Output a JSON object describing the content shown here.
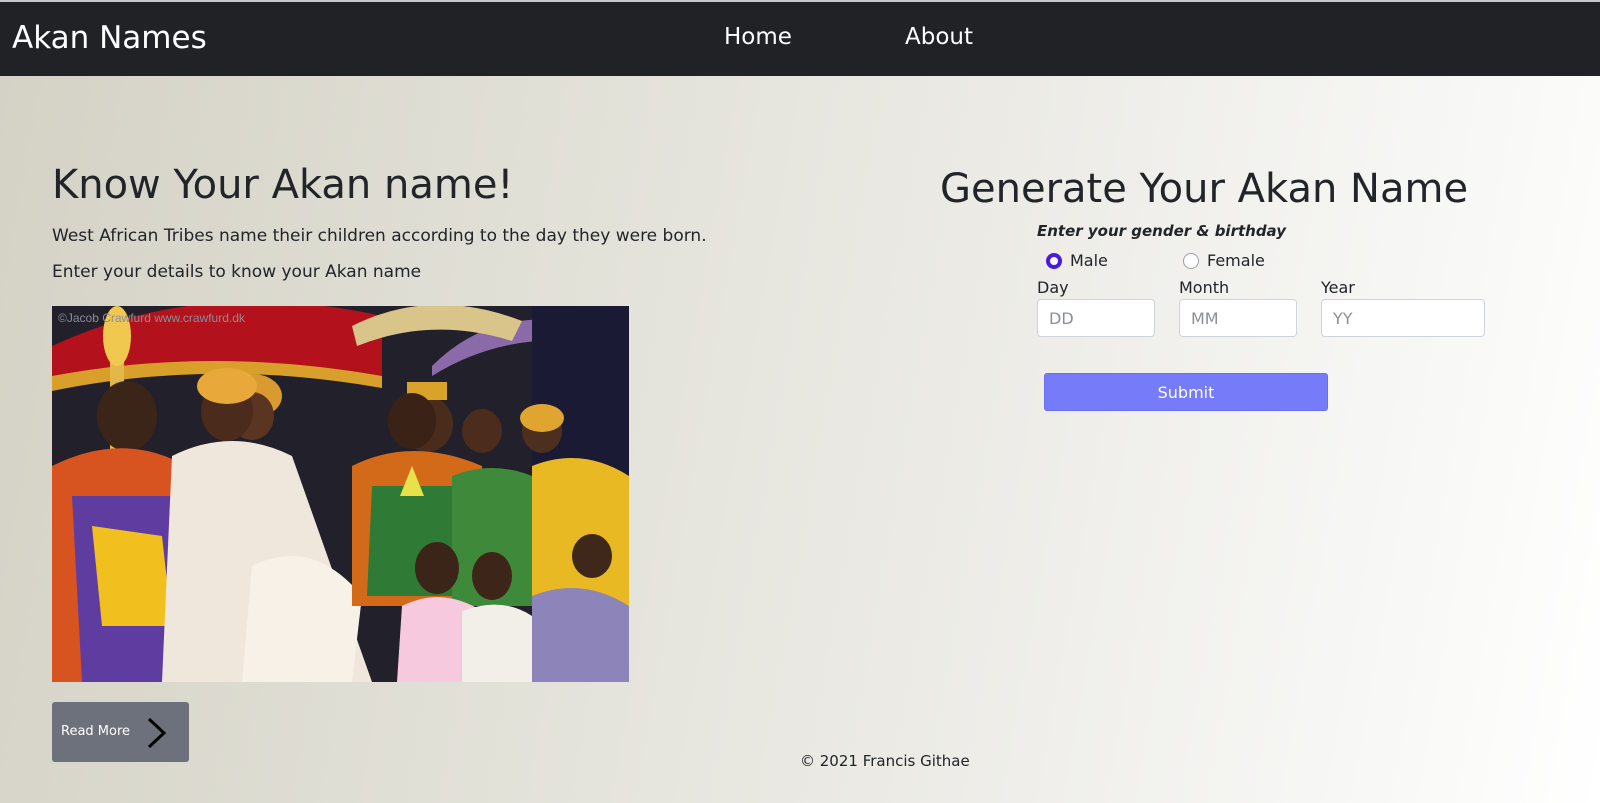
{
  "navbar": {
    "brand": "Akan Names",
    "links": [
      {
        "label": "Home"
      },
      {
        "label": "About"
      }
    ]
  },
  "intro": {
    "heading": "Know Your Akan name!",
    "paragraph_1": "West African Tribes name their children according to the day they were born.",
    "paragraph_2": "Enter your details to know your Akan name",
    "image_watermark": "©Jacob Crawfurd   www.crawfurd.dk",
    "read_more_label": "Read More"
  },
  "form": {
    "heading": "Generate Your Akan Name",
    "caption": "Enter your gender & birthday",
    "gender_options": [
      {
        "label": "Male",
        "selected": true
      },
      {
        "label": "Female",
        "selected": false
      }
    ],
    "day": {
      "label": "Day",
      "placeholder": "DD",
      "value": ""
    },
    "month": {
      "label": "Month",
      "placeholder": "MM",
      "value": ""
    },
    "year": {
      "label": "Year",
      "placeholder": "YY",
      "value": ""
    },
    "submit_label": "Submit"
  },
  "footer": {
    "text": "© 2021 Francis Githae"
  },
  "colors": {
    "navbar_bg": "#212226",
    "submit_bg": "#767bfa",
    "read_more_bg": "#6c717c",
    "radio_accent": "#4b1ae0"
  },
  "icons": {
    "read_more": "chevron-right-icon"
  }
}
